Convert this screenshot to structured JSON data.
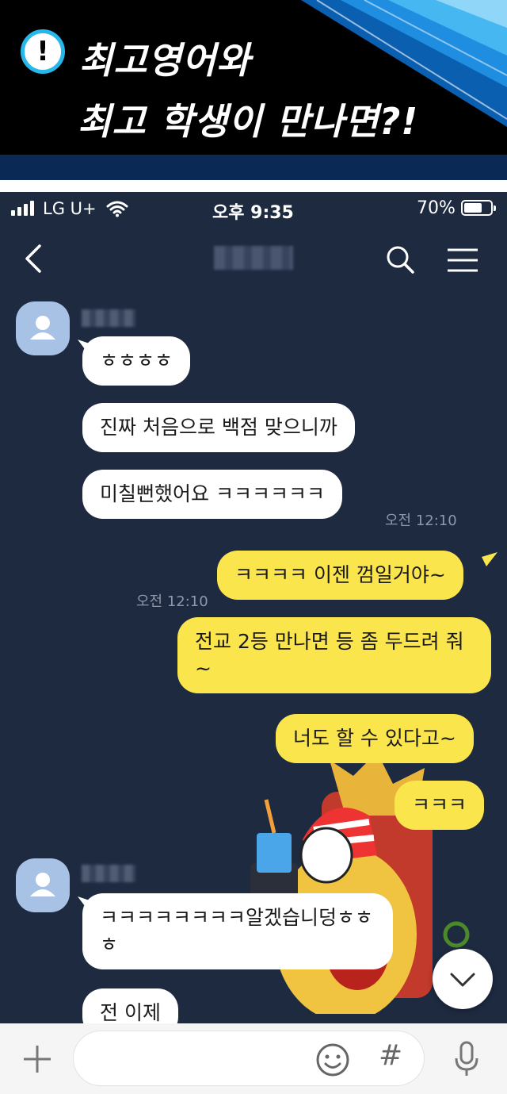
{
  "banner": {
    "alert_symbol": "!",
    "line1": "최고영어와",
    "line2": "최고 학생이 만나면?!"
  },
  "status_bar": {
    "carrier": "LG U+",
    "time": "오후 9:35",
    "battery": "70%",
    "battery_level": 0.7
  },
  "chat_header": {
    "icons": [
      "back-icon",
      "search-icon",
      "menu-icon"
    ]
  },
  "messages": [
    {
      "side": "in",
      "text": "ㅎㅎㅎㅎ"
    },
    {
      "side": "in",
      "text": "진짜 처음으로 백점 맞으니까"
    },
    {
      "side": "in",
      "text": "미칠뻔했어요 ㅋㅋㅋㅋㅋㅋ",
      "time": "오전 12:10"
    },
    {
      "side": "out",
      "text": "ㅋㅋㅋㅋ 이젠 껌일거야~",
      "time": "오전 12:10"
    },
    {
      "side": "out",
      "text": "전교 2등 만나면 등 좀 두드려 줘~"
    },
    {
      "side": "out",
      "text": "너도 할 수 있다고~"
    },
    {
      "side": "out",
      "text": "ㅋㅋㅋ"
    },
    {
      "side": "in",
      "text": "ㅋㅋㅋㅋㅋㅋㅋㅋ알겠습니덩ㅎㅎㅎ"
    },
    {
      "side": "in",
      "text": "전 이제"
    }
  ],
  "input_bar": {
    "placeholder": "",
    "hash_symbol": "#"
  },
  "colors": {
    "chat_background": "#1e2a40",
    "incoming_bubble": "#ffffff",
    "outgoing_bubble": "#fbe54c",
    "avatar": "#a8c2e6",
    "banner_accent": "#27b8ea"
  }
}
